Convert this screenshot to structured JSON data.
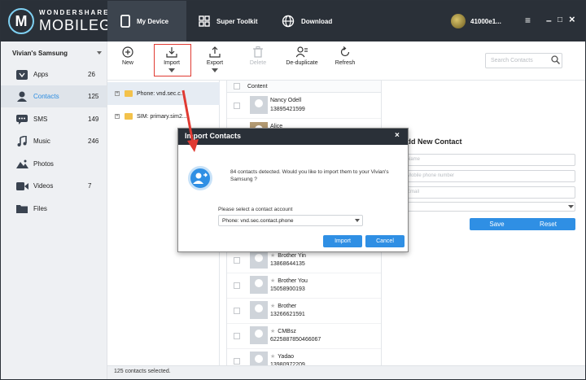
{
  "brand": {
    "line1": "WONDERSHARE",
    "line2": "MOBILEGO",
    "logo_letter": "M"
  },
  "nav": {
    "tabs": [
      {
        "label": "My Device"
      },
      {
        "label": "Super Toolkit"
      },
      {
        "label": "Download"
      }
    ]
  },
  "account": {
    "name": "41000e1..."
  },
  "window": {
    "menu": "≡",
    "minimize": "–",
    "maximize": "□",
    "close": "×"
  },
  "sidebar": {
    "device": "Vivian's Samsung",
    "items": [
      {
        "label": "Apps",
        "count": "26",
        "icon": "apps-icon"
      },
      {
        "label": "Contacts",
        "count": "125",
        "icon": "contacts-icon"
      },
      {
        "label": "SMS",
        "count": "149",
        "icon": "sms-icon"
      },
      {
        "label": "Music",
        "count": "246",
        "icon": "music-icon"
      },
      {
        "label": "Photos",
        "count": "",
        "icon": "photos-icon"
      },
      {
        "label": "Videos",
        "count": "7",
        "icon": "videos-icon"
      },
      {
        "label": "Files",
        "count": "",
        "icon": "files-icon"
      }
    ]
  },
  "toolbar": {
    "new": "New",
    "import": "Import",
    "export": "Export",
    "delete": "Delete",
    "deduplicate": "De-duplicate",
    "refresh": "Refresh",
    "search_placeholder": "Search Contacts"
  },
  "tree": {
    "items": [
      {
        "label": "Phone: vnd.sec.c..."
      },
      {
        "label": "SIM: primary.sim2..."
      }
    ]
  },
  "list": {
    "header": "Content",
    "contacts": [
      {
        "name": "Nancy  Odell",
        "number": "13895421599",
        "star": false
      },
      {
        "name": "Alice",
        "number": "",
        "star": false
      },
      {
        "name": "Brother Yin",
        "number": "13868644135",
        "star": true
      },
      {
        "name": "Brother You",
        "number": "15058900193",
        "star": true
      },
      {
        "name": "Brother",
        "number": "13266621591",
        "star": true
      },
      {
        "name": "CMBsz",
        "number": "6225887850466067",
        "star": true
      },
      {
        "name": "Yadao",
        "number": "13980972209",
        "star": true
      }
    ]
  },
  "new_contact": {
    "title": "Add New Contact",
    "name_placeholder": "Name",
    "phone_placeholder": "Mobile phone number",
    "email_placeholder": "Email",
    "save": "Save",
    "reset": "Reset"
  },
  "status": {
    "text": "125 contacts selected."
  },
  "dialog": {
    "title": "Import Contacts",
    "message": "84 contacts detected. Would you like to import them to your Vivian's Samsung ?",
    "account_label": "Please select a contact account",
    "account_value": "Phone: vnd.sec.contact.phone",
    "import": "Import",
    "cancel": "Cancel",
    "close": "×"
  },
  "colors": {
    "accent": "#2f8fe4",
    "topbar": "#2a3038",
    "annotation": "#e03a32"
  }
}
